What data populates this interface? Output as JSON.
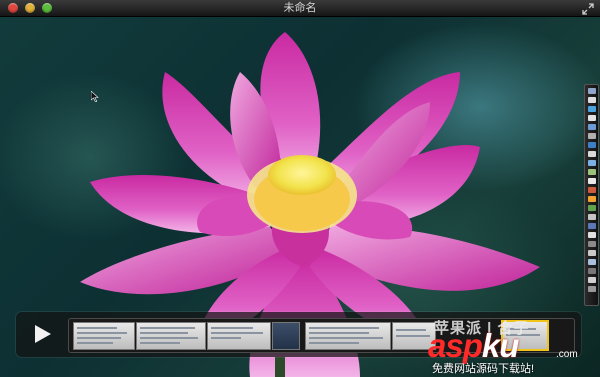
{
  "window": {
    "title": "未命名"
  },
  "icons": {
    "close": "close-icon",
    "minimize": "minimize-icon",
    "zoom": "zoom-icon",
    "fullscreen": "fullscreen-arrows-icon",
    "play": "play-icon",
    "cursor": "mouse-pointer-icon"
  },
  "colors": {
    "close": "#e2463f",
    "minimize": "#e0b23a",
    "zoom": "#5bbf3c",
    "petal": "#d63fb0",
    "petal_light": "#f3a8e6",
    "center": "#f2e34b",
    "selection": "#f0c419",
    "watermark_red": "#ff2a2a"
  },
  "watermark": {
    "top_text": "苹果派 | 合子",
    "logo_asp": "asp",
    "logo_ku": "ku",
    "logo_suffix": ".com",
    "subtitle": "免费网站源码下载站!"
  }
}
